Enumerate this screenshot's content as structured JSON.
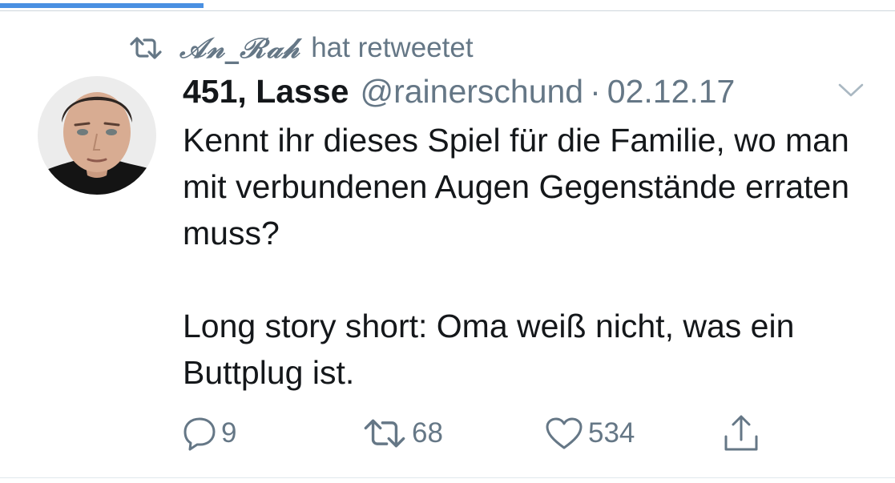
{
  "colors": {
    "accent": "#4a90e2",
    "secondary_text": "#657786",
    "primary_text": "#14171a"
  },
  "retweet_context": {
    "icon": "retweet-icon",
    "retweeter": "𝒜𝓃_ℛ𝒶𝒽",
    "label": "hat retweetet"
  },
  "tweet": {
    "avatar_icon": "user-avatar",
    "author_name": "451, Lasse",
    "handle": "@rainerschund",
    "separator": "·",
    "date": "02.12.17",
    "menu_icon": "chevron-down-icon",
    "text_paragraphs": [
      "Kennt ihr dieses Spiel für die Familie, wo man mit verbundenen Augen Gegenstände erraten muss?",
      "Long story short: Oma weiß nicht, was ein Buttplug ist."
    ],
    "actions": {
      "reply": {
        "icon": "reply-icon",
        "count": "9"
      },
      "retweet": {
        "icon": "retweet-icon",
        "count": "68"
      },
      "like": {
        "icon": "heart-icon",
        "count": "534"
      },
      "share": {
        "icon": "share-icon"
      }
    }
  }
}
